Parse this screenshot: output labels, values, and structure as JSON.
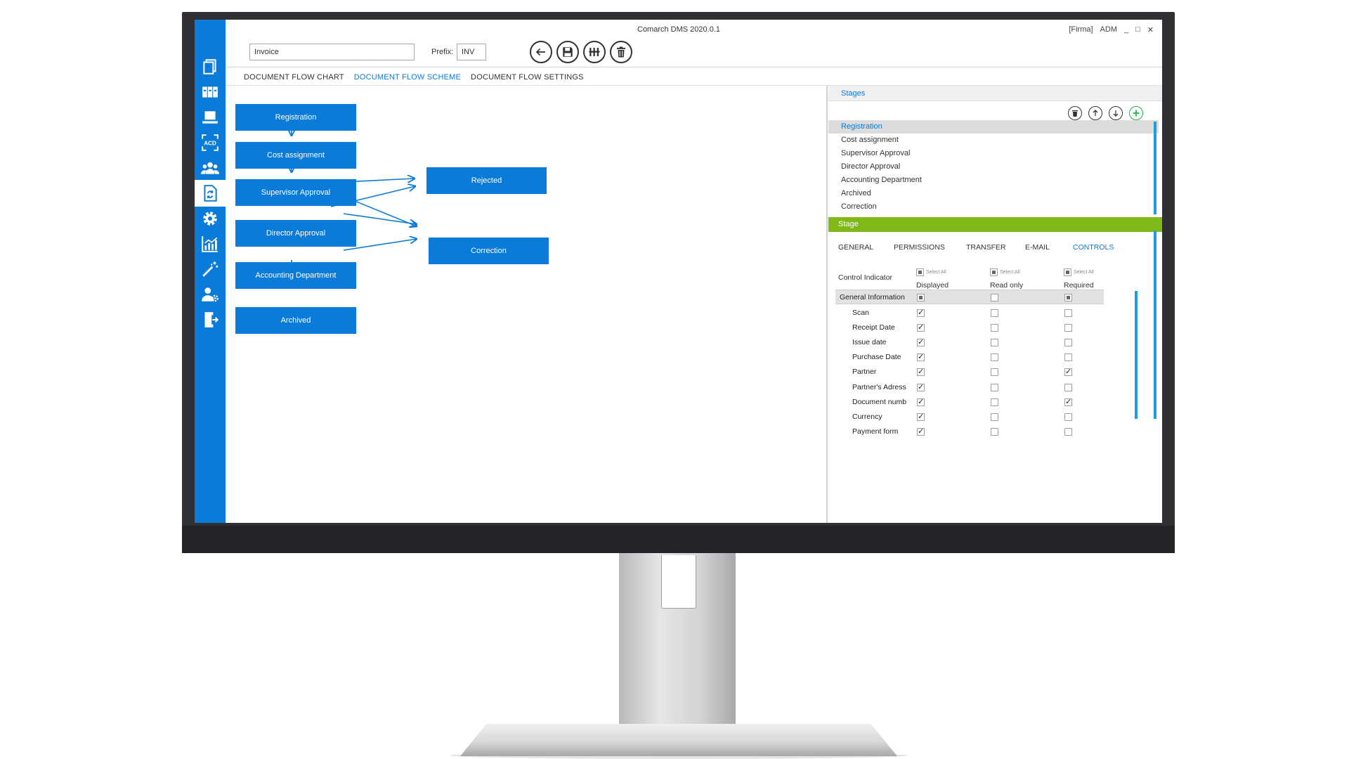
{
  "app": {
    "title": "Comarch DMS 2020.0.1",
    "company": "[Firma]",
    "user": "ADM",
    "minimize": "_",
    "maximize": "□",
    "close": "✕"
  },
  "header": {
    "name_value": "Invoice",
    "prefix_label": "Prefix:",
    "prefix_value": "INV"
  },
  "toolbar": {
    "buttons": [
      "back-icon",
      "save-icon",
      "add-stage-icon",
      "delete-icon"
    ]
  },
  "sidebar": {
    "icons": [
      "documents-icon",
      "binders-icon",
      "workstation-icon",
      "ocr-icon",
      "users-group-icon",
      "document-flow-icon",
      "settings-icon",
      "reports-icon",
      "magic-wand-icon",
      "user-settings-icon",
      "logout-icon"
    ],
    "active_index": 5
  },
  "tabs": [
    "DOCUMENT FLOW CHART",
    "DOCUMENT FLOW SCHEME",
    "DOCUMENT FLOW SETTINGS"
  ],
  "active_tab": 1,
  "flow_boxes": [
    "Registration",
    "Cost assignment",
    "Supervisor Approval",
    "Director Approval",
    "Accounting Department",
    "Archived",
    "Rejected",
    "Correction"
  ],
  "stages": {
    "title": "Stages",
    "buttons": [
      "delete-icon",
      "move-up-icon",
      "move-down-icon",
      "add-icon"
    ],
    "items": [
      "Registration",
      "Cost assignment",
      "Supervisor Approval",
      "Director Approval",
      "Accounting Department",
      "Archived",
      "Correction"
    ],
    "selected_index": 0
  },
  "stage": {
    "title": "Stage",
    "tabs": [
      "GENERAL",
      "PERMISSIONS",
      "TRANSFER",
      "E-MAIL",
      "CONTROLS"
    ],
    "active_tab": 4,
    "control_indicator_label": "Control Indicator",
    "select_all_label": "Select All",
    "columns": [
      "Displayed",
      "Read only",
      "Required"
    ],
    "group": "General Information",
    "rows": [
      {
        "label": "Scan",
        "displayed": true,
        "read_only": false,
        "required": false
      },
      {
        "label": "Receipt Date",
        "displayed": true,
        "read_only": false,
        "required": false
      },
      {
        "label": "Issue date",
        "displayed": true,
        "read_only": false,
        "required": false
      },
      {
        "label": "Purchase Date",
        "displayed": true,
        "read_only": false,
        "required": false
      },
      {
        "label": "Partner",
        "displayed": true,
        "read_only": false,
        "required": true
      },
      {
        "label": "Partner's Adress",
        "displayed": true,
        "read_only": false,
        "required": false
      },
      {
        "label": "Document numb",
        "displayed": true,
        "read_only": false,
        "required": true
      },
      {
        "label": "Currency",
        "displayed": true,
        "read_only": false,
        "required": false
      },
      {
        "label": "Payment form",
        "displayed": true,
        "read_only": false,
        "required": false
      }
    ]
  },
  "colors": {
    "accent": "#0a7bd8",
    "stage_bar": "#80b818",
    "scroll": "#1a9ee0"
  }
}
